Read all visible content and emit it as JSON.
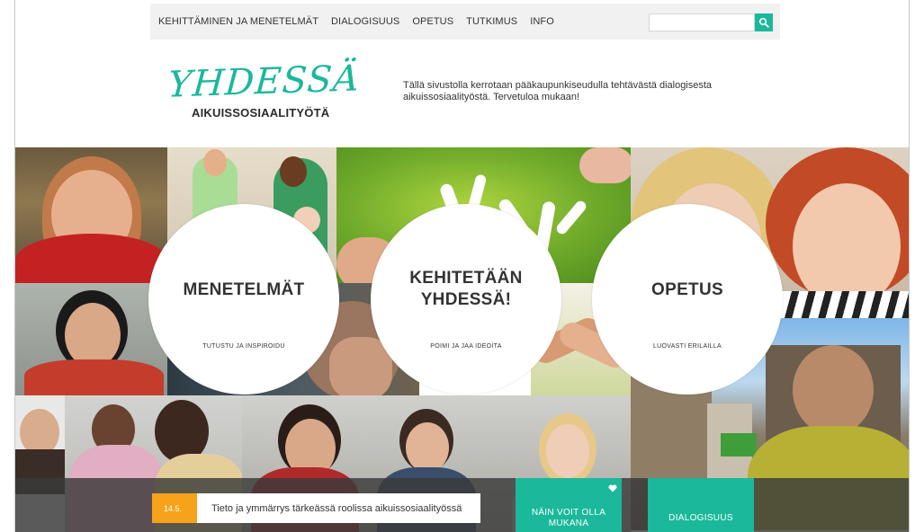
{
  "nav": {
    "items": [
      "KEHITTÄMINEN JA MENETELMÄT",
      "DIALOGISUUS",
      "OPETUS",
      "TUTKIMUS",
      "INFO"
    ],
    "search_placeholder": ""
  },
  "logo": {
    "script": "YHDESSÄ",
    "subtitle": "AIKUISSOSIAALITYÖTÄ"
  },
  "intro": "Tällä sivustolla kerrotaan pääkaupunkiseudulla tehtävästä dialogisesta aikuissosiaalityöstä. Tervetuloa mukaan!",
  "circles": [
    {
      "title": "MENETELMÄT",
      "subtitle": "TUTUSTU JA INSPIROIDU"
    },
    {
      "title_line1": "KEHITETÄÄN",
      "title_line2": "YHDESSÄ!",
      "subtitle": "POIMI JA JAA IDEOITA"
    },
    {
      "title": "OPETUS",
      "subtitle": "LUOVASTI ERILAILLA"
    }
  ],
  "news": {
    "date": "14.5.",
    "text": "Tieto ja ymmärrys tärkeässä roolissa aikuissosiaalityössä"
  },
  "cta": {
    "join_line1": "NÄIN VOIT OLLA",
    "join_line2": "MUKANA",
    "dialog": "DIALOGISUUS"
  },
  "colors": {
    "accent": "#1bb89b",
    "news_date": "#f7a21b"
  },
  "icons": {
    "search": "search-icon",
    "heart": "heart-icon"
  }
}
